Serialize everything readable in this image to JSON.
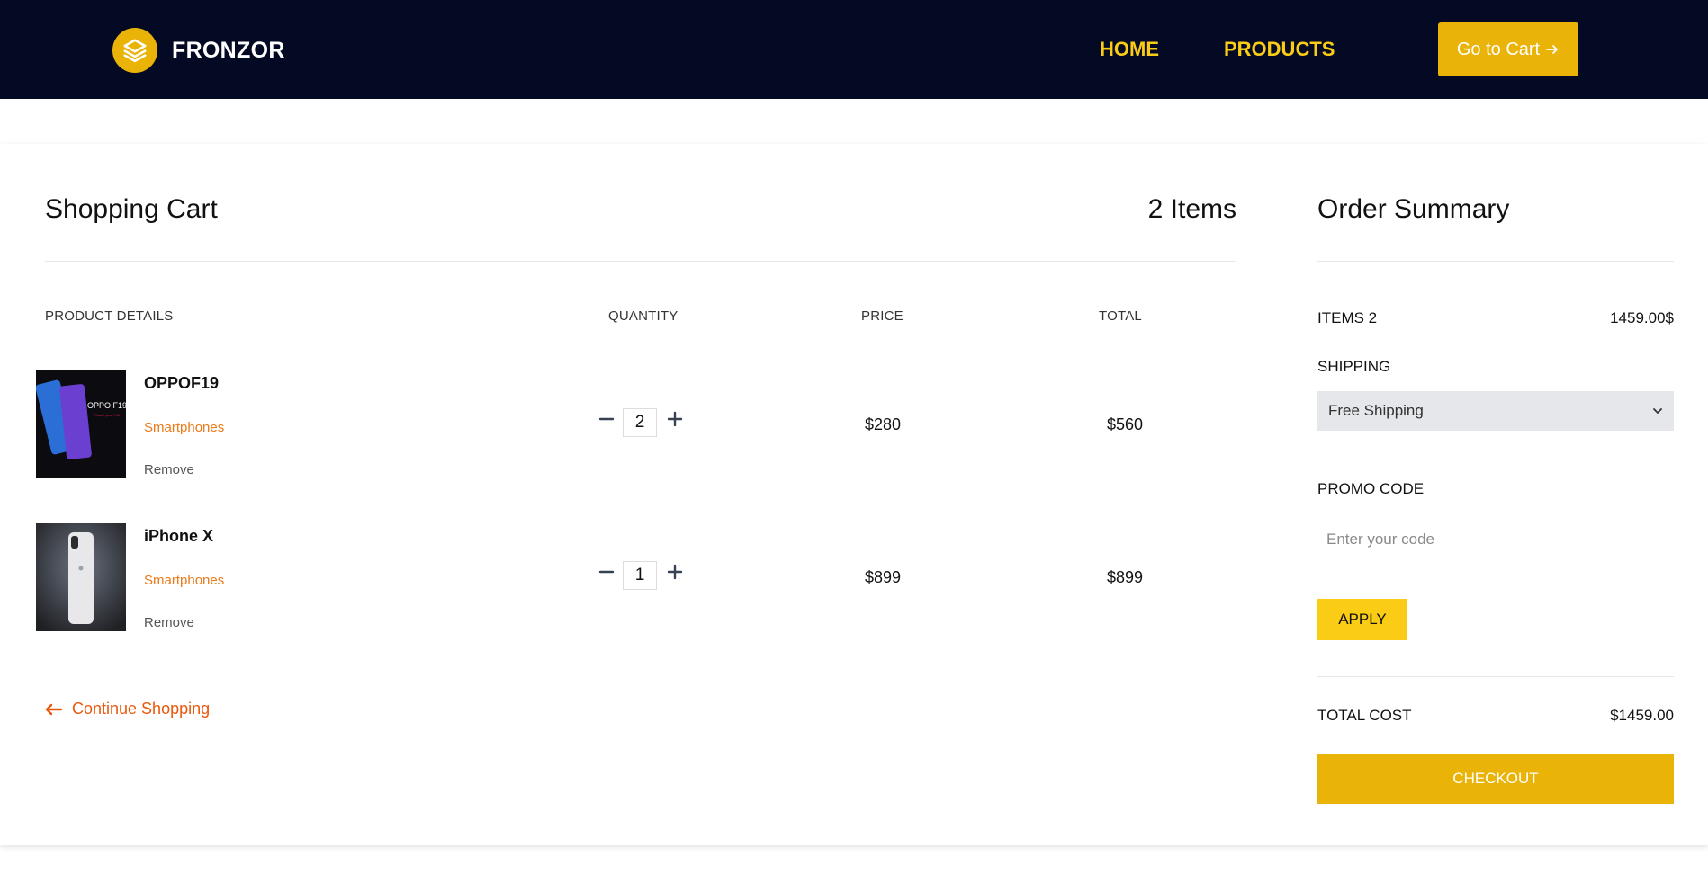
{
  "brand": {
    "name": "FRONZOR"
  },
  "nav": {
    "home": "HOME",
    "products": "PRODUCTS",
    "go_to_cart": "Go to Cart"
  },
  "cart": {
    "title": "Shopping Cart",
    "items_count": "2 Items",
    "columns": [
      "PRODUCT DETAILS",
      "QUANTITY",
      "PRICE",
      "TOTAL"
    ],
    "items": [
      {
        "name": "OPPOF19",
        "category": "Smartphones",
        "remove": "Remove",
        "quantity": "2",
        "price": "$280",
        "total": "$560"
      },
      {
        "name": "iPhone X",
        "category": "Smartphones",
        "remove": "Remove",
        "quantity": "1",
        "price": "$899",
        "total": "$899"
      }
    ],
    "continue_shopping": "Continue Shopping"
  },
  "summary": {
    "title": "Order Summary",
    "items_label": "ITEMS 2",
    "items_value": "1459.00$",
    "shipping_label": "SHIPPING",
    "shipping_selected": "Free Shipping",
    "promo_label": "PROMO CODE",
    "promo_placeholder": "Enter your code",
    "apply": "APPLY",
    "total_label": "TOTAL COST",
    "total_value": "$1459.00",
    "checkout": "CHECKOUT"
  },
  "colors": {
    "navbar": "#050a24",
    "accent": "#eab308",
    "nav_link": "#facc15",
    "category": "#ea7a1a",
    "continue": "#ea580c"
  },
  "icons": [
    "layers-icon",
    "arrow-right-icon",
    "minus-icon",
    "plus-icon",
    "arrow-left-icon",
    "chevron-down-icon"
  ]
}
